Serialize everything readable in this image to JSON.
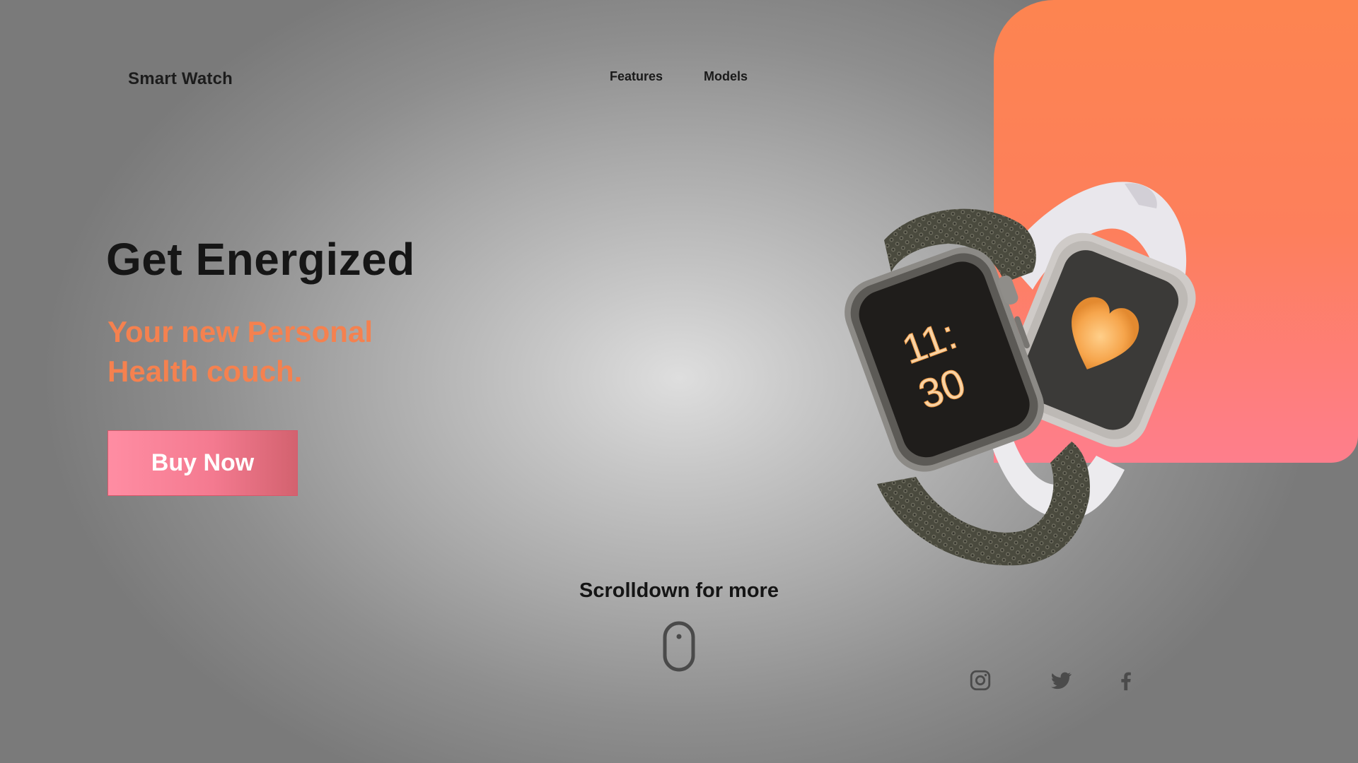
{
  "header": {
    "brand": "Smart Watch",
    "nav": [
      {
        "label": "Features",
        "icon": ""
      },
      {
        "label": "Models",
        "icon": ""
      }
    ]
  },
  "hero": {
    "headline": "Get Energized",
    "subline": "Your new Personal Health couch.",
    "cta_label": "Buy Now"
  },
  "watch": {
    "time_hours": "11:",
    "time_minutes": "30"
  },
  "scroll": {
    "text": "Scrolldown for more",
    "icon": "mouse-icon"
  },
  "social": [
    {
      "icon": "instagram-icon"
    },
    {
      "icon": "twitter-icon"
    },
    {
      "icon": "facebook-icon"
    }
  ],
  "colors": {
    "accent_orange": "#f5814f",
    "button_pink": "#f47a90",
    "panel_top": "#fd8450",
    "panel_bottom": "#fe7e8c",
    "text_dark": "#161616"
  }
}
